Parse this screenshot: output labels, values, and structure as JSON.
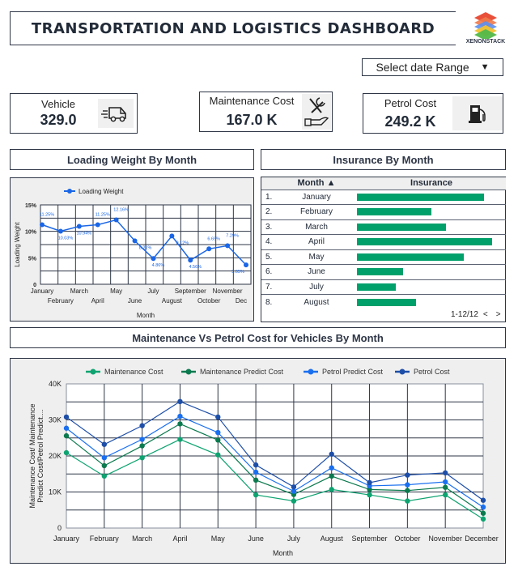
{
  "header": {
    "title": "TRANSPORTATION AND LOGISTICS DASHBOARD",
    "logo_text": "XENONSTACK",
    "date_range_label": "Select date Range",
    "date_range_icon": "triangle-down"
  },
  "kpis": [
    {
      "label": "Vehicle",
      "value": "329.0",
      "icon": "delivery-van-icon"
    },
    {
      "label": "Maintenance Cost",
      "value": "167.0 K",
      "icon": "tools-hand-icon"
    },
    {
      "label": "Petrol Cost",
      "value": "249.2 K",
      "icon": "fuel-pump-icon"
    }
  ],
  "loading_weight": {
    "panel_title": "Loading Weight By Month"
  },
  "insurance": {
    "panel_title": "Insurance By Month",
    "col_month": "Month ▲",
    "col_insurance": "Insurance",
    "rows": [
      {
        "idx": "1.",
        "month": "January",
        "rel": 0.94
      },
      {
        "idx": "2.",
        "month": "February",
        "rel": 0.55
      },
      {
        "idx": "3.",
        "month": "March",
        "rel": 0.66
      },
      {
        "idx": "4.",
        "month": "April",
        "rel": 1.0
      },
      {
        "idx": "5.",
        "month": "May",
        "rel": 0.79
      },
      {
        "idx": "6.",
        "month": "June",
        "rel": 0.34
      },
      {
        "idx": "7.",
        "month": "July",
        "rel": 0.29
      },
      {
        "idx": "8.",
        "month": "August",
        "rel": 0.44
      }
    ],
    "pagination": "1-12/12",
    "prev": "<",
    "next": ">",
    "bar_color": "#00a06b"
  },
  "cost_chart": {
    "panel_title": "Maintenance Vs Petrol Cost for Vehicles By Month"
  },
  "chart_data": [
    {
      "type": "line",
      "title": "Loading Weight By Month",
      "xlabel": "Month",
      "ylabel": "Loading Weight",
      "categories": [
        "January",
        "February",
        "March",
        "April",
        "May",
        "June",
        "July",
        "August",
        "September",
        "October",
        "November",
        "Dec"
      ],
      "series": [
        {
          "name": "Loading Weight",
          "color": "#1a66e6",
          "values": [
            11.25,
            10.03,
            10.94,
            11.25,
            12.16,
            8.21,
            4.86,
            9.12,
            4.56,
            6.69,
            7.29,
            3.65
          ],
          "labels": [
            "11.25%",
            "10.03%",
            "10.94%",
            "11.25%",
            "12.16%",
            "8.21%",
            "4.86%",
            "9.12%",
            "4.56%",
            "6.69%",
            "7.29%",
            "3.65%"
          ]
        }
      ],
      "ylim": [
        0,
        15
      ],
      "yticks": [
        0,
        5,
        10,
        15
      ],
      "ytick_labels": [
        "0",
        "5%",
        "10%",
        "15%"
      ],
      "grid": true,
      "legend": "top"
    },
    {
      "type": "line",
      "title": "Maintenance Vs Petrol Cost for Vehicles By Month",
      "xlabel": "Month",
      "ylabel": "Maintenance Cost/ Maintenance Predict Cost/Petrol Predict....",
      "categories": [
        "January",
        "February",
        "March",
        "April",
        "May",
        "June",
        "July",
        "August",
        "September",
        "October",
        "November",
        "December"
      ],
      "series": [
        {
          "name": "Maintenance Cost",
          "color": "#0ea371",
          "values": [
            20900,
            14400,
            19500,
            24600,
            20300,
            9200,
            7500,
            10700,
            9200,
            7500,
            9200,
            2500
          ]
        },
        {
          "name": "Maintenance Predict Cost",
          "color": "#0b7a4e",
          "values": [
            25600,
            17300,
            22800,
            28900,
            24400,
            13300,
            9300,
            14400,
            10700,
            10400,
            11300,
            4100
          ]
        },
        {
          "name": "Petrol Predict Cost",
          "color": "#1a6fef",
          "values": [
            27700,
            19500,
            24600,
            31000,
            26500,
            15500,
            10200,
            16700,
            11700,
            12000,
            12800,
            5800
          ]
        },
        {
          "name": "Petrol Cost",
          "color": "#1d4ea8",
          "values": [
            30800,
            23200,
            28400,
            35100,
            30800,
            17500,
            11400,
            20500,
            12600,
            14700,
            15300,
            7700
          ]
        }
      ],
      "ylim": [
        0,
        40000
      ],
      "yticks": [
        0,
        10000,
        20000,
        30000,
        40000
      ],
      "ytick_labels": [
        "0",
        "10K",
        "20K",
        "30K",
        "40K"
      ],
      "grid": true,
      "legend": "top"
    }
  ]
}
